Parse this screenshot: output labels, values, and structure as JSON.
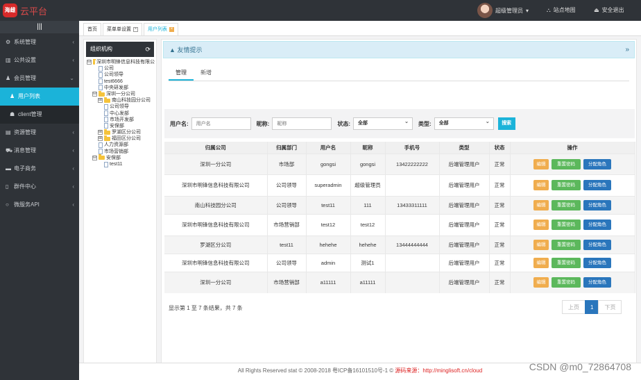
{
  "header": {
    "logo": "海雌",
    "brand": "云平台",
    "user": "超级管理员",
    "map": "站点地图",
    "logout": "安全退出"
  },
  "sidebar": {
    "toggle": "|||",
    "items": [
      {
        "icon": "⚙",
        "label": "系统管理",
        "arrow": "‹"
      },
      {
        "icon": "▥",
        "label": "公共设置",
        "arrow": "‹"
      },
      {
        "icon": "♟",
        "label": "会员管理",
        "arrow": "⌄"
      },
      {
        "icon": "♟",
        "label": "用户列表",
        "arrow": ""
      },
      {
        "icon": "☗",
        "label": "client管理",
        "arrow": ""
      },
      {
        "icon": "▤",
        "label": "资源管理",
        "arrow": "‹"
      },
      {
        "icon": "⛟",
        "label": "消息管理",
        "arrow": "‹"
      },
      {
        "icon": "▬",
        "label": "电子商务",
        "arrow": "‹"
      },
      {
        "icon": "▯",
        "label": "群件中心",
        "arrow": "‹"
      },
      {
        "icon": "○",
        "label": "微服务API",
        "arrow": "‹"
      }
    ]
  },
  "tabs": [
    {
      "label": "首页"
    },
    {
      "label": "菜单单设置"
    },
    {
      "label": "用户列表"
    }
  ],
  "org": {
    "title": "组织机构",
    "nodes": [
      {
        "t": "深圳市明锋信息科技有限公",
        "k": "fold",
        "d": 0,
        "pm": "⊟"
      },
      {
        "t": "公司",
        "k": "file",
        "d": 1,
        "pm": ""
      },
      {
        "t": "公司领导",
        "k": "file",
        "d": 1,
        "pm": ""
      },
      {
        "t": "test6666",
        "k": "file",
        "d": 1,
        "pm": ""
      },
      {
        "t": "中央研发部",
        "k": "file",
        "d": 1,
        "pm": ""
      },
      {
        "t": "深圳一分公司",
        "k": "fold",
        "d": 1,
        "pm": "⊟"
      },
      {
        "t": "南山科技园分公司",
        "k": "fold",
        "d": 2,
        "pm": "⊞"
      },
      {
        "t": "公司领导",
        "k": "file",
        "d": 2,
        "pm": ""
      },
      {
        "t": "中心发部",
        "k": "file",
        "d": 2,
        "pm": ""
      },
      {
        "t": "市场开发部",
        "k": "file",
        "d": 2,
        "pm": ""
      },
      {
        "t": "安保部",
        "k": "file",
        "d": 2,
        "pm": ""
      },
      {
        "t": "罗湖区分公司",
        "k": "fold",
        "d": 2,
        "pm": "⊞"
      },
      {
        "t": "福田区分公司",
        "k": "fold",
        "d": 2,
        "pm": "⊞"
      },
      {
        "t": "人力资源部",
        "k": "file",
        "d": 1,
        "pm": ""
      },
      {
        "t": "市场营销部",
        "k": "file",
        "d": 1,
        "pm": ""
      },
      {
        "t": "安保部",
        "k": "fold",
        "d": 1,
        "pm": "⊟"
      },
      {
        "t": "test11",
        "k": "file",
        "d": 2,
        "pm": ""
      }
    ]
  },
  "notice": "友情提示",
  "subtabs": [
    "管理",
    "新增"
  ],
  "form": {
    "username_label": "用户名:",
    "username_ph": "用户名",
    "nick_label": "昵称:",
    "nick_ph": "昵称",
    "status_label": "状态:",
    "status_value": "全部",
    "type_label": "类型:",
    "type_value": "全部",
    "search": "搜索"
  },
  "table": {
    "headers": [
      "归属公司",
      "归属部门",
      "用户名",
      "昵称",
      "手机号",
      "类型",
      "状态",
      "操作"
    ],
    "rows": [
      {
        "company": "深圳一分公司",
        "dept": "市场部",
        "user": "gongsi",
        "nick": "gongsi",
        "phone": "13422222222",
        "type": "后端管理用户",
        "status": "正常",
        "btn2": "重置密码"
      },
      {
        "company": "深圳市明锋信息科技有限公司",
        "dept": "公司领导",
        "user": "superadmin",
        "nick": "超级管理员",
        "phone": "",
        "type": "后端管理用户",
        "status": "正常",
        "btn2": "重置密码"
      },
      {
        "company": "南山科技园分公司",
        "dept": "公司领导",
        "user": "test11",
        "nick": "111",
        "phone": "13433311111",
        "type": "后端管理用户",
        "status": "正常",
        "btn2": "重置密码"
      },
      {
        "company": "深圳市明锋信息科技有限公司",
        "dept": "市场营销部",
        "user": "test12",
        "nick": "test12",
        "phone": "",
        "type": "后端管理用户",
        "status": "正常",
        "btn2": "重置密码"
      },
      {
        "company": "罗湖区分公司",
        "dept": "test11",
        "user": "hehehe",
        "nick": "hehehe",
        "phone": "13444444444",
        "type": "后端管理用户",
        "status": "正常",
        "btn2": "重置密码"
      },
      {
        "company": "深圳市明锋信息科技有限公司",
        "dept": "公司领导",
        "user": "admin",
        "nick": "测试1",
        "phone": "",
        "type": "后端管理用户",
        "status": "正常",
        "btn2": "重置密码"
      },
      {
        "company": "深圳一分公司",
        "dept": "市场营销部",
        "user": "a11111",
        "nick": "a11111",
        "phone": "",
        "type": "后端管理用户",
        "status": "正常",
        "btn2": "重置密码"
      }
    ],
    "btn_edit": "编辑",
    "btn_assign": "分配角色"
  },
  "summary": "显示第 1 至 7 条结果，共 7 条",
  "pager": {
    "prev": "上页",
    "cur": "1",
    "next": "下页"
  },
  "footer": {
    "text": "All Rights Reserved stat © 2008-2018 粤ICP备16101510号-1 © ",
    "src": "源码来源：http://minglisoft.cn/cloud"
  },
  "watermark": "CSDN @m0_72864708"
}
